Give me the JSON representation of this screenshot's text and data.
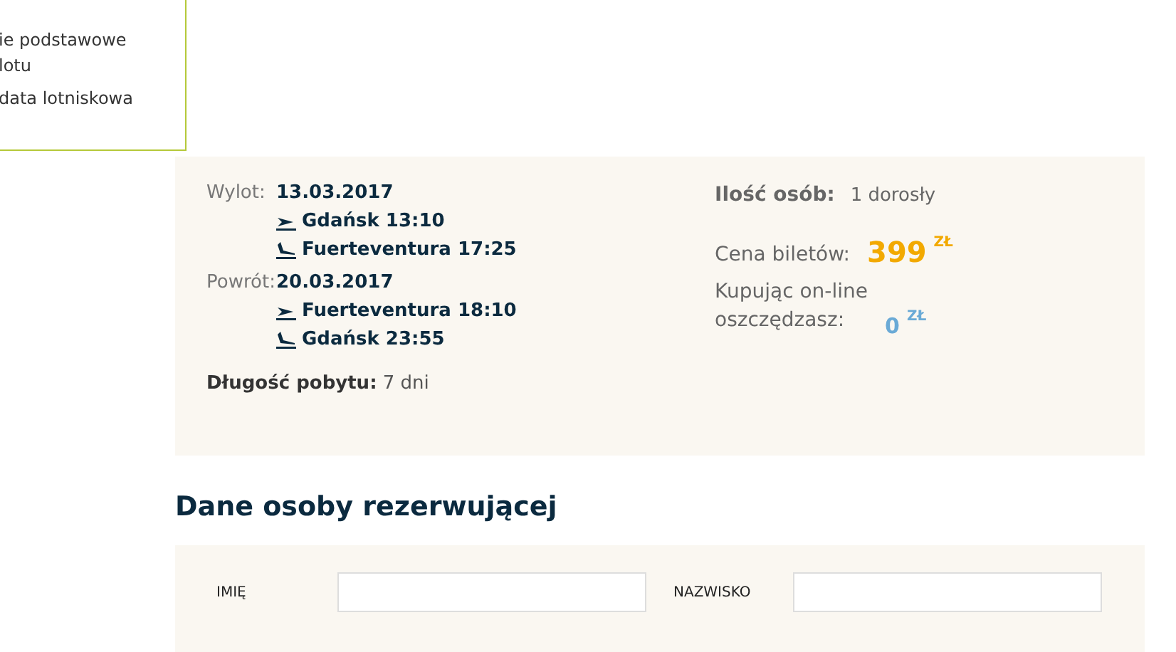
{
  "menu": {
    "items": [
      {
        "lines": [
          "ie podstawowe",
          "lotu"
        ]
      },
      {
        "lines": [
          "data lotniskowa"
        ]
      }
    ]
  },
  "summary": {
    "legs": [
      {
        "label": "Wylot:",
        "date": "13.03.2017",
        "segments": [
          {
            "kind": "departure",
            "text": "Gdańsk 13:10"
          },
          {
            "kind": "arrival",
            "text": "Fuerteventura 17:25"
          }
        ]
      },
      {
        "label": "Powrót:",
        "date": "20.03.2017",
        "segments": [
          {
            "kind": "departure",
            "text": "Fuerteventura 18:10"
          },
          {
            "kind": "arrival",
            "text": "Gdańsk 23:55"
          }
        ]
      }
    ],
    "stay": {
      "label": "Długość pobytu:",
      "value": "7 dni"
    },
    "persons": {
      "label": "Ilość osób:",
      "value": "1 dorosły"
    },
    "price": {
      "label": "Cena biletów:",
      "amount": "399",
      "currency": "ZŁ"
    },
    "savings": {
      "label_lines": [
        "Kupując on-line",
        "oszczędzasz:"
      ],
      "amount": "0",
      "currency": "ZŁ"
    }
  },
  "section_title": "Dane osoby rezerwującej",
  "form": {
    "fields": [
      {
        "label": "IMIĘ"
      },
      {
        "label": "NAZWISKO"
      }
    ]
  }
}
